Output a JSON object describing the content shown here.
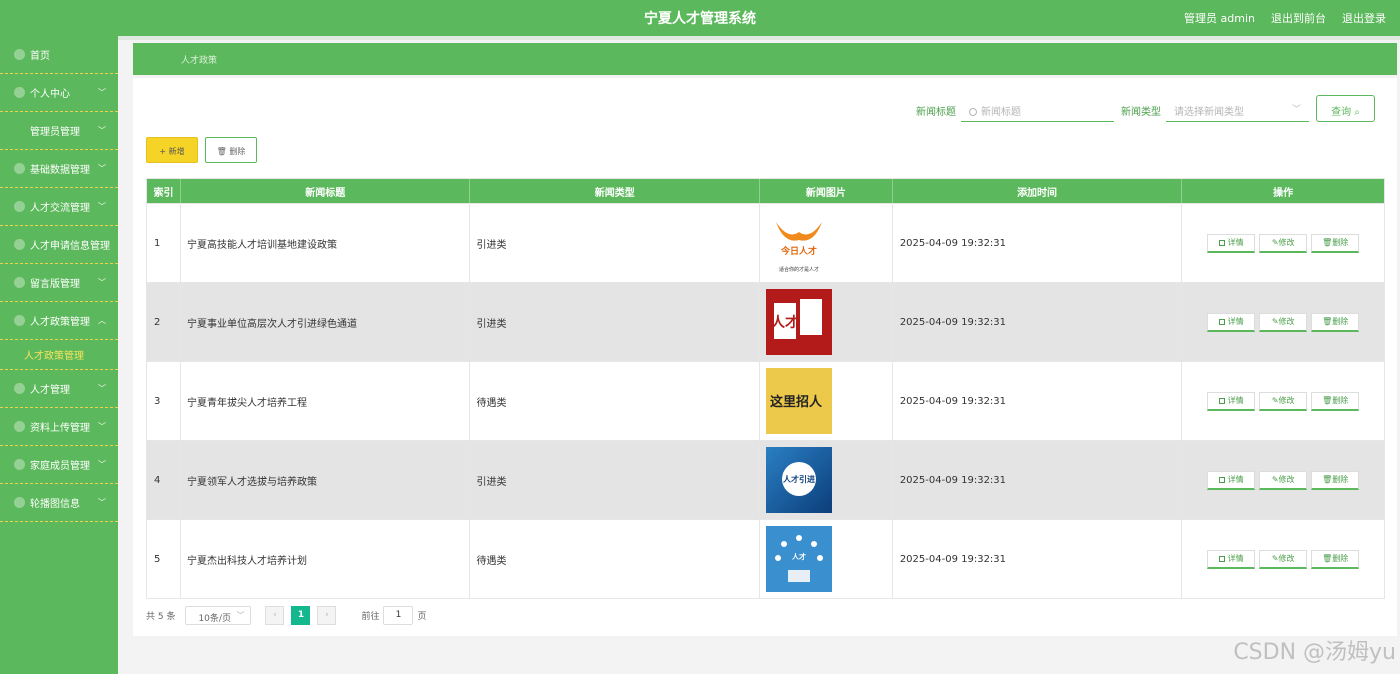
{
  "header": {
    "title": "宁夏人才管理系统",
    "user": "管理员 admin",
    "to_front": "退出到前台",
    "logout": "退出登录"
  },
  "sidebar": {
    "items": [
      {
        "label": "首页"
      },
      {
        "label": "个人中心"
      },
      {
        "label": "管理员管理"
      },
      {
        "label": "基础数据管理"
      },
      {
        "label": "人才交流管理"
      },
      {
        "label": "人才申请信息管理"
      },
      {
        "label": "留言版管理"
      },
      {
        "label": "人才政策管理"
      },
      {
        "label": "人才政策管理"
      },
      {
        "label": "人才管理"
      },
      {
        "label": "资料上传管理"
      },
      {
        "label": "家庭成员管理"
      },
      {
        "label": "轮播图信息"
      }
    ]
  },
  "breadcrumb": "人才政策",
  "search": {
    "title_label": "新闻标题",
    "title_placeholder": "新闻标题",
    "type_label": "新闻类型",
    "type_placeholder": "请选择新闻类型",
    "query_label": "查询"
  },
  "actions": {
    "add": "+ 新增",
    "delete": "删除"
  },
  "table": {
    "headers": [
      "索引",
      "新闻标题",
      "新闻类型",
      "新闻图片",
      "添加时间",
      "操作"
    ],
    "rows": [
      {
        "index": "1",
        "title": "宁夏高技能人才培训基地建设政策",
        "type": "引进类",
        "time": "2025-04-09 19:32:31"
      },
      {
        "index": "2",
        "title": "宁夏事业单位高层次人才引进绿色通道",
        "type": "引进类",
        "time": "2025-04-09 19:32:31"
      },
      {
        "index": "3",
        "title": "宁夏青年拔尖人才培养工程",
        "type": "待遇类",
        "time": "2025-04-09 19:32:31"
      },
      {
        "index": "4",
        "title": "宁夏领军人才选拔与培养政策",
        "type": "引进类",
        "time": "2025-04-09 19:32:31"
      },
      {
        "index": "5",
        "title": "宁夏杰出科技人才培养计划",
        "type": "待遇类",
        "time": "2025-04-09 19:32:31"
      }
    ],
    "op_detail": "详情",
    "op_edit": "修改",
    "op_delete": "删除",
    "image_texts": {
      "img1_brand": "今日人才",
      "img1_slogan": "适合你的才是人才",
      "img2": "人才",
      "img3": "这里招人",
      "img4": "人才引进",
      "img5": "人才"
    }
  },
  "pager": {
    "total": "共 5 条",
    "page_size": "10条/页",
    "current": "1",
    "goto_label": "前往",
    "goto_value": "1",
    "page_suffix": "页"
  },
  "watermark": "CSDN @汤姆yu"
}
